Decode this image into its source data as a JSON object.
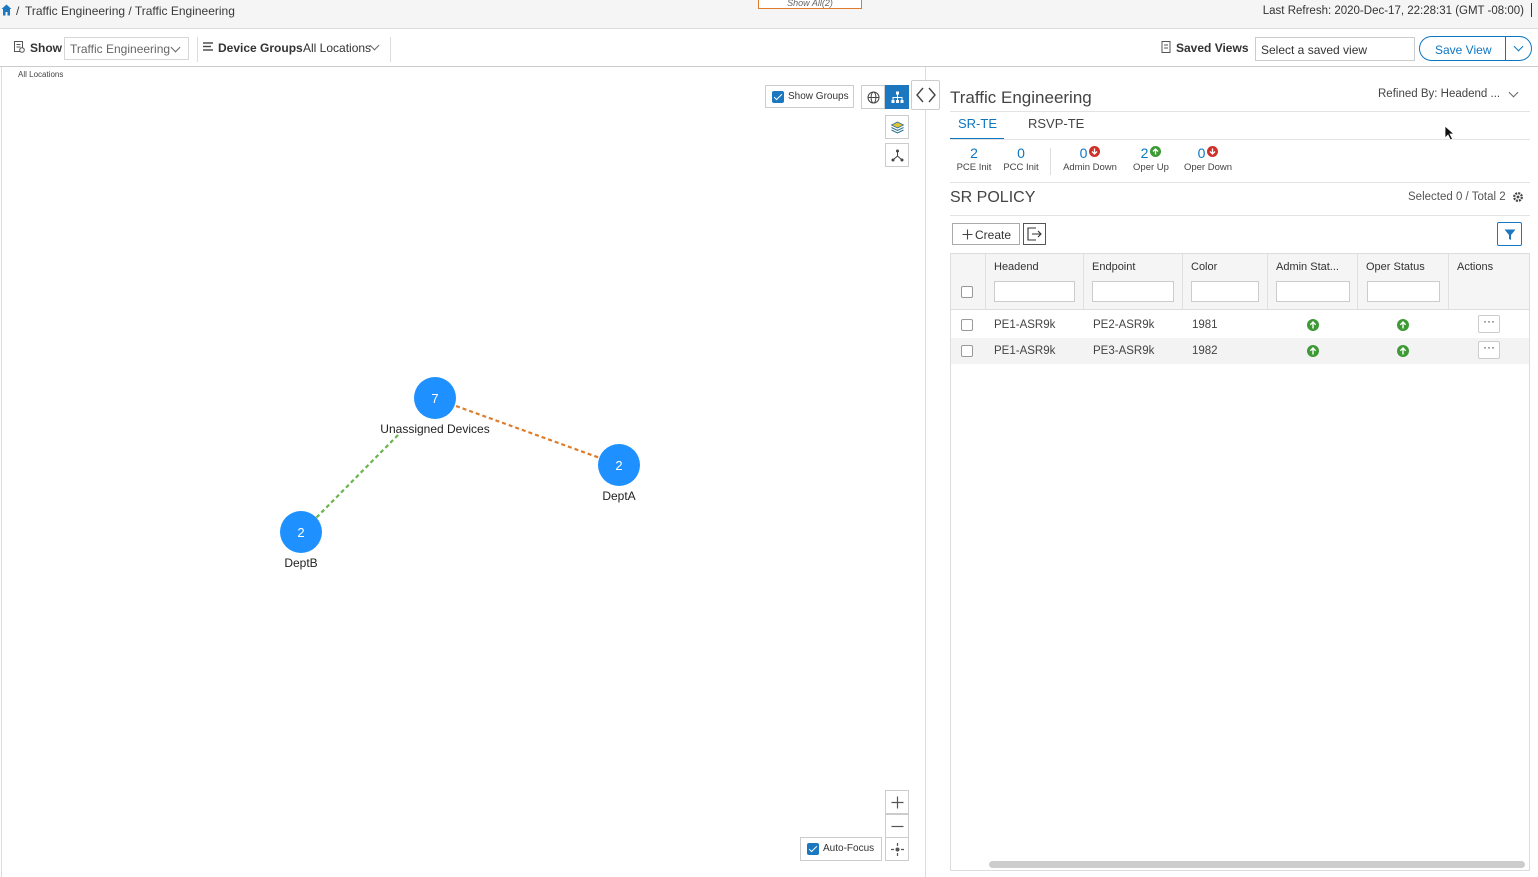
{
  "breadcrumb": {
    "separator": "/",
    "path": "Traffic Engineering / Traffic Engineering"
  },
  "show_all_label": "Show All(2)",
  "last_refresh": "Last Refresh: 2020-Dec-17, 22:28:31 (GMT -08:00)",
  "toolbar": {
    "show_label": "Show",
    "show_value": "Traffic Engineering",
    "device_groups_label": "Device Groups",
    "device_groups_value": "All Locations",
    "saved_views_label": "Saved Views",
    "saved_view_placeholder": "Select a saved view",
    "save_view_label": "Save View"
  },
  "map": {
    "location_label": "All Locations",
    "show_groups_label": "Show Groups",
    "auto_focus_label": "Auto-Focus",
    "nodes": [
      {
        "id": "unassigned",
        "count": "7",
        "label": "Unassigned Devices"
      },
      {
        "id": "depta",
        "count": "2",
        "label": "DeptA"
      },
      {
        "id": "deptb",
        "count": "2",
        "label": "DeptB"
      }
    ],
    "link_colors": {
      "orange": "#e07b27",
      "green": "#6cb54a"
    },
    "node_color": "#1e90ff"
  },
  "panel": {
    "title": "Traffic Engineering",
    "refined_by": "Refined By: Headend ...",
    "tabs": [
      {
        "label": "SR-TE",
        "active": true
      },
      {
        "label": "RSVP-TE",
        "active": false
      }
    ],
    "stats": [
      {
        "value": "2",
        "label": "PCE Init",
        "icon": ""
      },
      {
        "value": "0",
        "label": "PCC Init",
        "icon": ""
      },
      {
        "value": "0",
        "label": "Admin Down",
        "icon": "arrow-down-icon"
      },
      {
        "value": "2",
        "label": "Oper Up",
        "icon": "arrow-up-icon"
      },
      {
        "value": "0",
        "label": "Oper Down",
        "icon": "arrow-down-icon"
      }
    ],
    "section_title": "SR POLICY",
    "selection_count": "Selected 0 / Total 2",
    "create_label": "Create",
    "columns": [
      "Headend",
      "Endpoint",
      "Color",
      "Admin Stat...",
      "Oper Status",
      "Actions"
    ],
    "rows": [
      {
        "headend": "PE1-ASR9k",
        "endpoint": "PE2-ASR9k",
        "color": "1981",
        "admin_status": "up",
        "oper_status": "up"
      },
      {
        "headend": "PE1-ASR9k",
        "endpoint": "PE3-ASR9k",
        "color": "1982",
        "admin_status": "up",
        "oper_status": "up"
      }
    ],
    "actions_glyph": "···"
  },
  "colors": {
    "accent": "#0d76c1",
    "status_up": "#3e9a34",
    "status_down": "#d0302a"
  }
}
